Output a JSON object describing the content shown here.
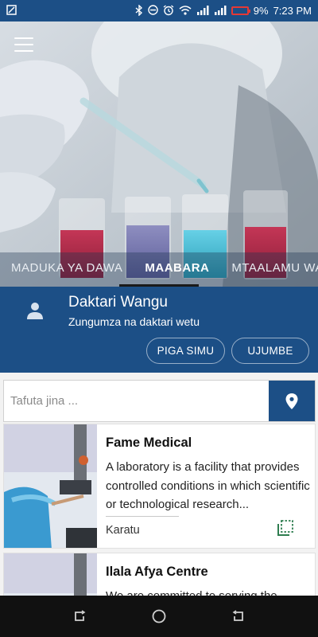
{
  "status_bar": {
    "battery": "9%",
    "time": "7:23 PM"
  },
  "tabs": [
    {
      "label": "MADUKA YA DAWA"
    },
    {
      "label": "MAABARA"
    },
    {
      "label": "MTAALAMU WA LISHE"
    }
  ],
  "active_tab": "MAABARA",
  "doctor_panel": {
    "title": "Daktari Wangu",
    "subtitle": "Zungumza na daktari wetu",
    "call_label": "PIGA SIMU",
    "message_label": "UJUMBE"
  },
  "search": {
    "placeholder": "Tafuta jina ...",
    "value": ""
  },
  "listings": [
    {
      "name": "Fame Medical",
      "description": "A laboratory is a facility that provides controlled conditions in which scientific or technological research...",
      "location": "Karatu"
    },
    {
      "name": "Ilala Afya Centre",
      "description": "We are committed to serving the",
      "location": ""
    }
  ],
  "colors": {
    "primary": "#1c4f86",
    "accent_green": "#2e7d4f",
    "battery_low": "#e53935"
  },
  "icons": {
    "menu": "hamburger-icon",
    "person": "person-icon",
    "location": "location-pin-icon",
    "card_action": "copy-icon"
  }
}
